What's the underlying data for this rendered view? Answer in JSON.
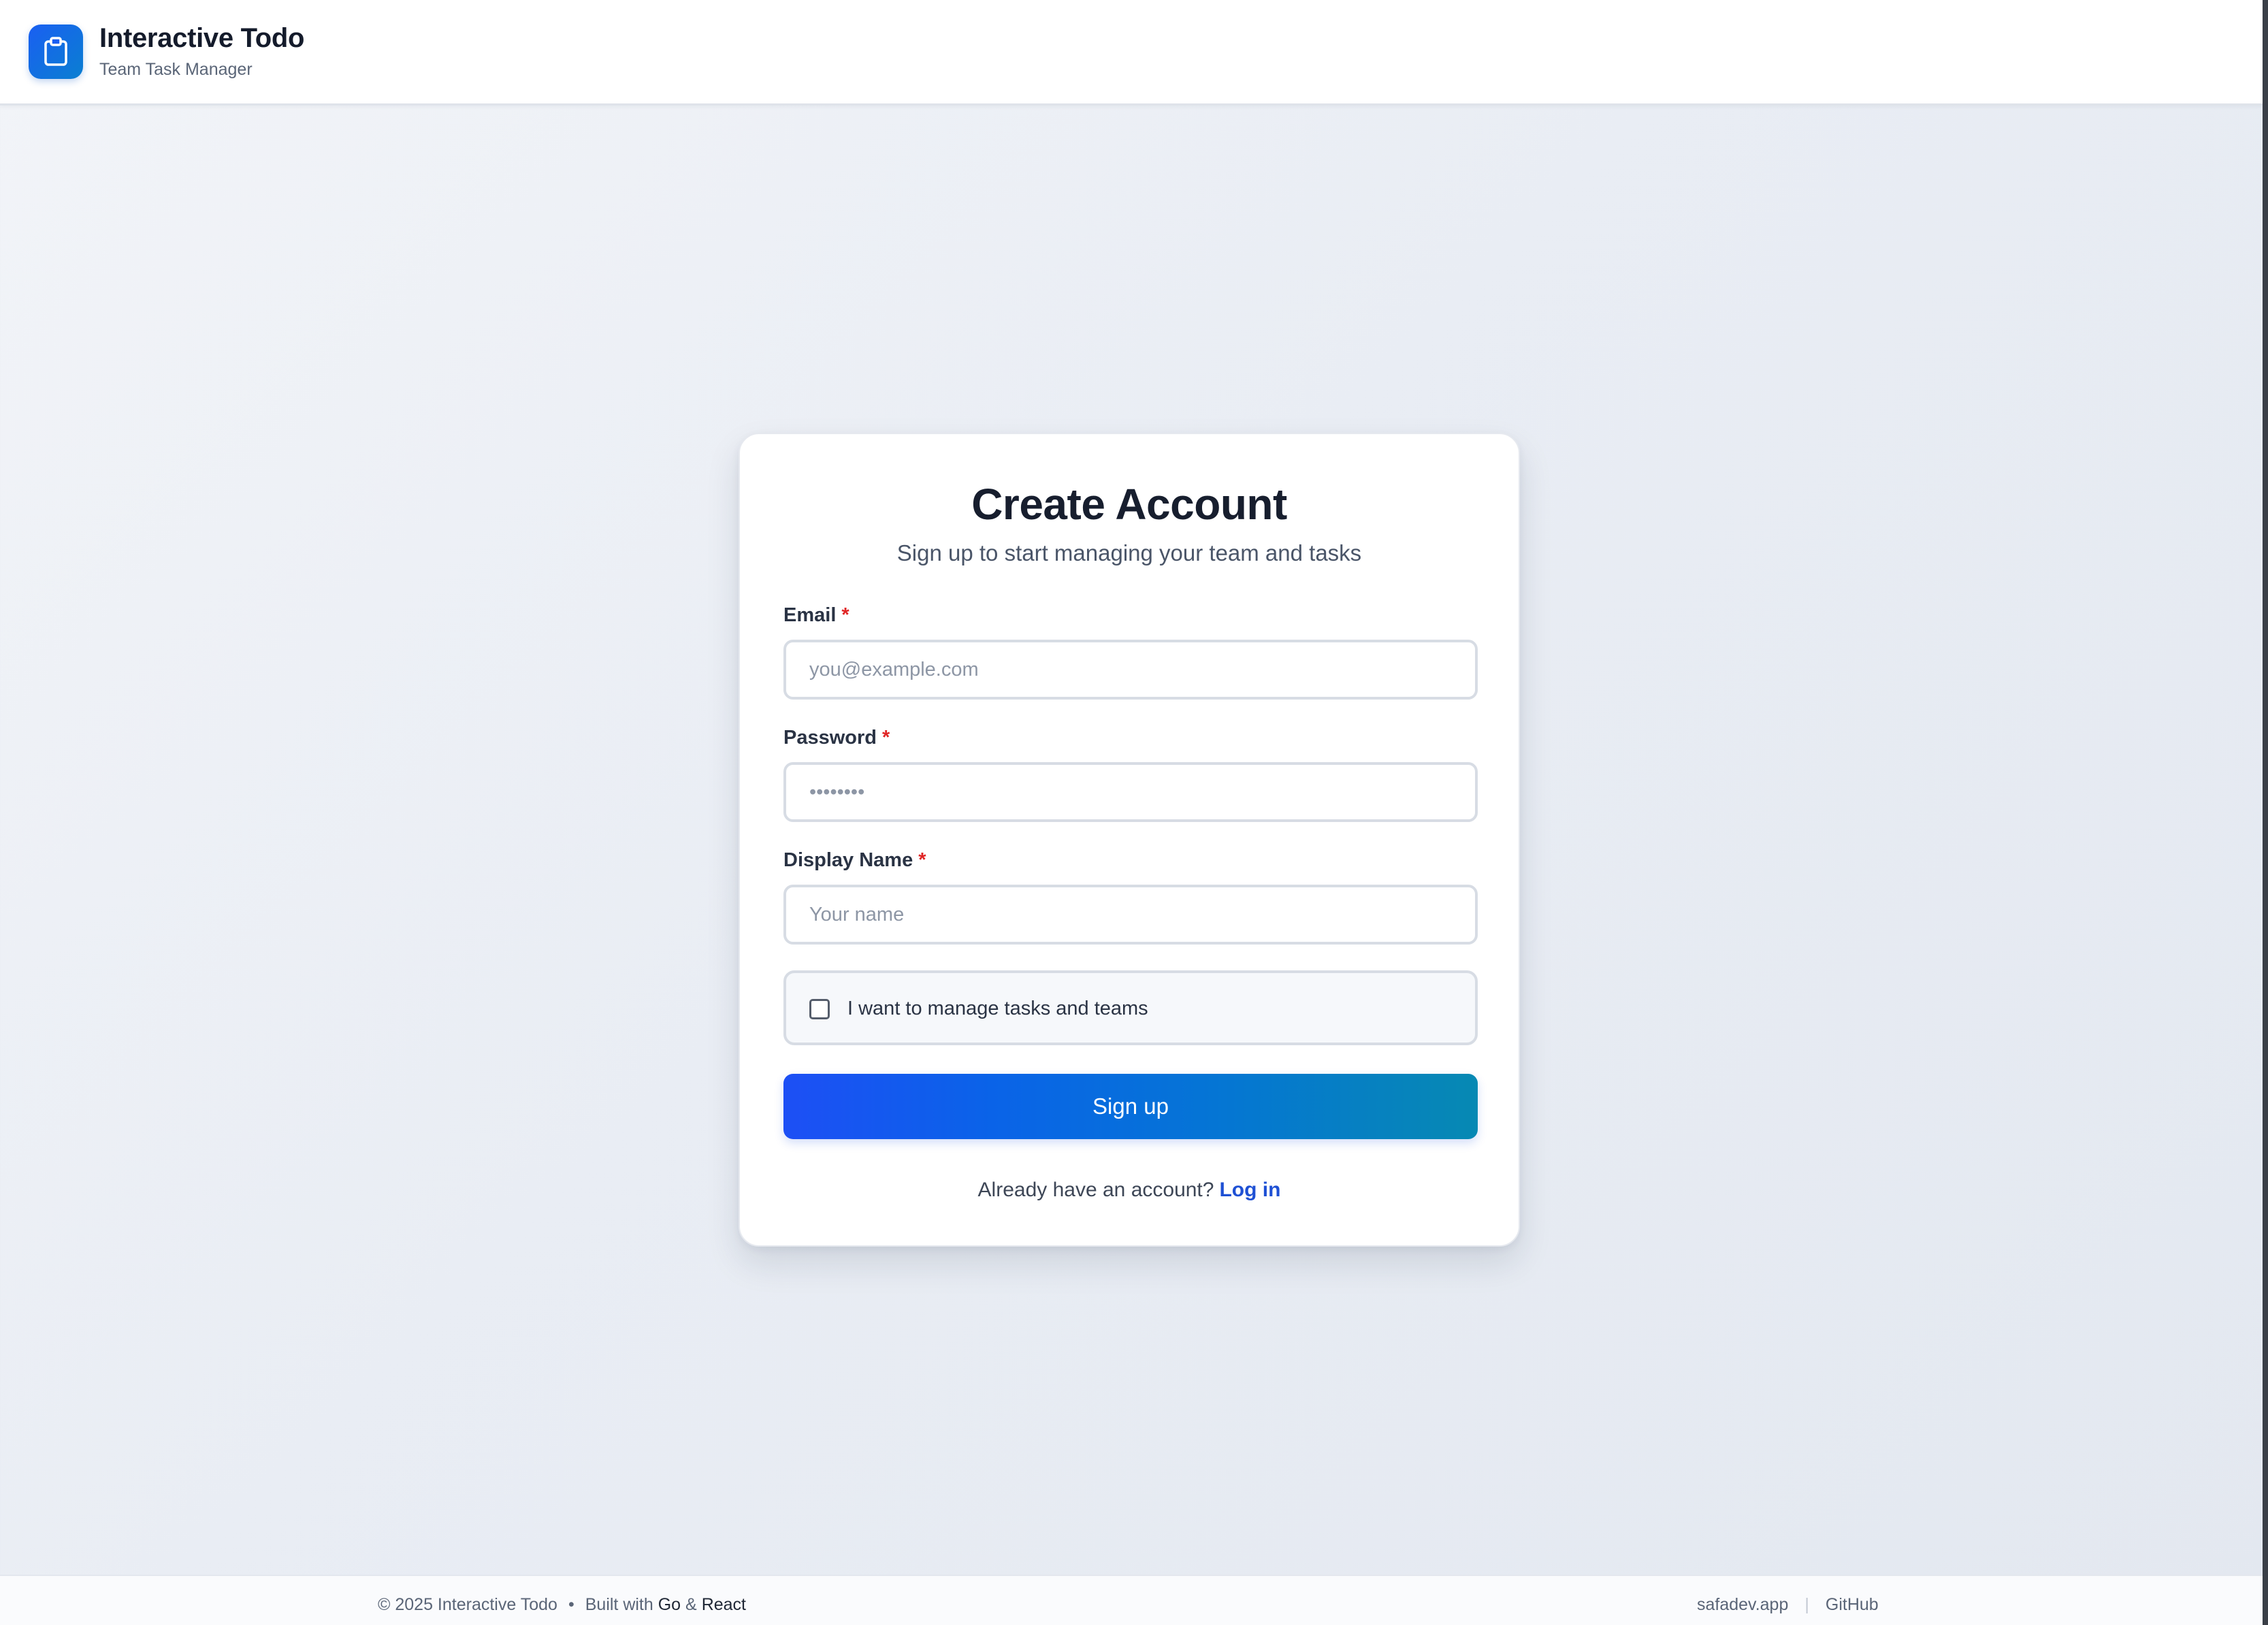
{
  "header": {
    "logo_icon": "clipboard-icon",
    "title": "Interactive Todo",
    "subtitle": "Team Task Manager"
  },
  "signup_form": {
    "title": "Create Account",
    "subtitle": "Sign up to start managing your team and tasks",
    "email": {
      "label": "Email",
      "required_marker": "*",
      "placeholder": "you@example.com",
      "value": ""
    },
    "password": {
      "label": "Password",
      "required_marker": "*",
      "placeholder": "••••••••",
      "value": ""
    },
    "display_name": {
      "label": "Display Name",
      "required_marker": "*",
      "placeholder": "Your name",
      "value": ""
    },
    "manager_checkbox": {
      "label": "I want to manage tasks and teams",
      "checked": false
    },
    "submit_label": "Sign up",
    "login_prompt": "Already have an account?",
    "login_link": "Log in"
  },
  "footer": {
    "copyright": "© 2025 Interactive Todo",
    "separator": "•",
    "built_with": "Built with",
    "tech_1": "Go",
    "ampersand": "&",
    "tech_2": "React",
    "link_site": "safadev.app",
    "link_separator": "|",
    "link_github": "GitHub"
  },
  "colors": {
    "accent": "#1e50d4",
    "button_gradient_start": "#1d4ff5",
    "button_gradient_end": "#0689b3",
    "required": "#e02424"
  }
}
